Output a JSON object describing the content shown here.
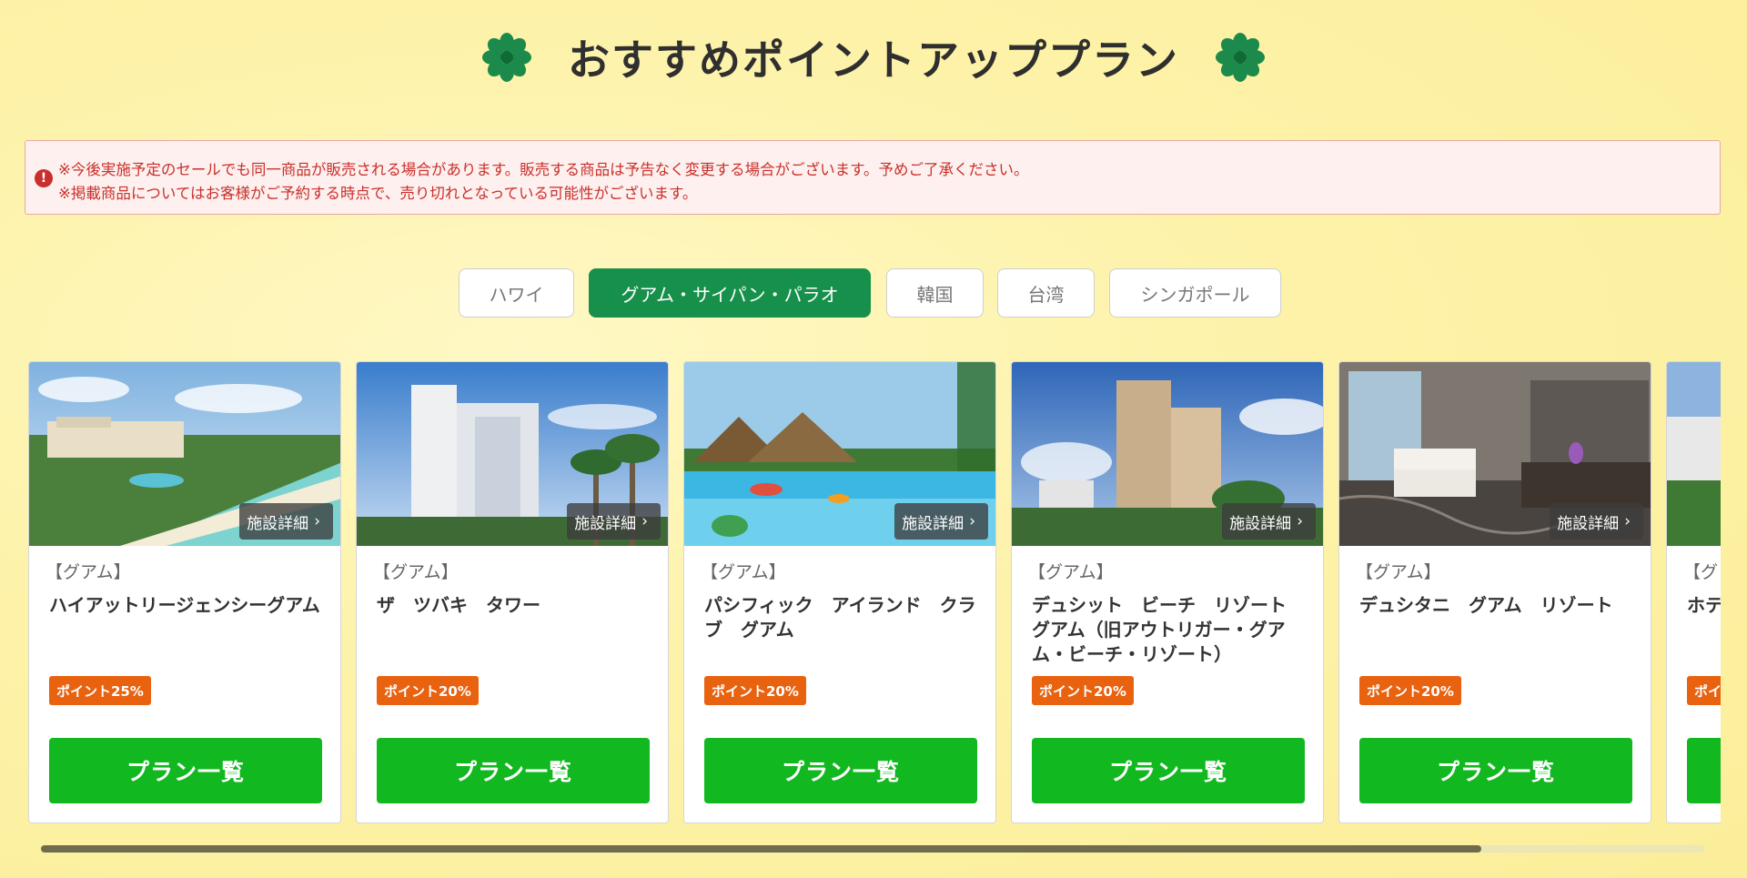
{
  "page": {
    "title": "おすすめポイントアッププラン"
  },
  "icons": {
    "title_left": "flower-icon",
    "title_right": "flower-icon",
    "notice": "alert-icon",
    "detail": "chevron-right-icon"
  },
  "colors": {
    "accent_green": "#17904b",
    "plan_button": "#12b81f",
    "badge": "#e8620f",
    "notice_text": "#c9302c"
  },
  "notice": {
    "line1": "※今後実施予定のセールでも同一商品が販売される場合があります。販売する商品は予告なく変更する場合がございます。予めご了承ください。",
    "line2": "※掲載商品についてはお客様がご予約する時点で、売り切れとなっている可能性がございます。"
  },
  "tabs": [
    {
      "label": "ハワイ",
      "active": false
    },
    {
      "label": "グアム・サイパン・パラオ",
      "active": true
    },
    {
      "label": "韓国",
      "active": false
    },
    {
      "label": "台湾",
      "active": false
    },
    {
      "label": "シンガポール",
      "active": false
    }
  ],
  "cards": [
    {
      "area": "【グアム】",
      "name": "ハイアットリージェンシーグアム",
      "badge": "ポイント25%",
      "detail_label": "施設詳細",
      "button": "プラン一覧"
    },
    {
      "area": "【グアム】",
      "name": "ザ　ツバキ　タワー",
      "badge": "ポイント20%",
      "detail_label": "施設詳細",
      "button": "プラン一覧"
    },
    {
      "area": "【グアム】",
      "name": "パシフィック　アイランド　クラブ　グアム",
      "badge": "ポイント20%",
      "detail_label": "施設詳細",
      "button": "プラン一覧"
    },
    {
      "area": "【グアム】",
      "name": "デュシット　ビーチ　リゾート　グアム（旧アウトリガー・グアム・ビーチ・リゾート）",
      "badge": "ポイント20%",
      "detail_label": "施設詳細",
      "button": "プラン一覧"
    },
    {
      "area": "【グアム】",
      "name": "デュシタニ　グアム　リゾート",
      "badge": "ポイント20%",
      "detail_label": "施設詳細",
      "button": "プラン一覧"
    },
    {
      "area": "【グ",
      "name": "ホテ",
      "badge": "ポイ",
      "detail_label": "",
      "button": ""
    }
  ],
  "scroll": {
    "position": 0.866
  }
}
